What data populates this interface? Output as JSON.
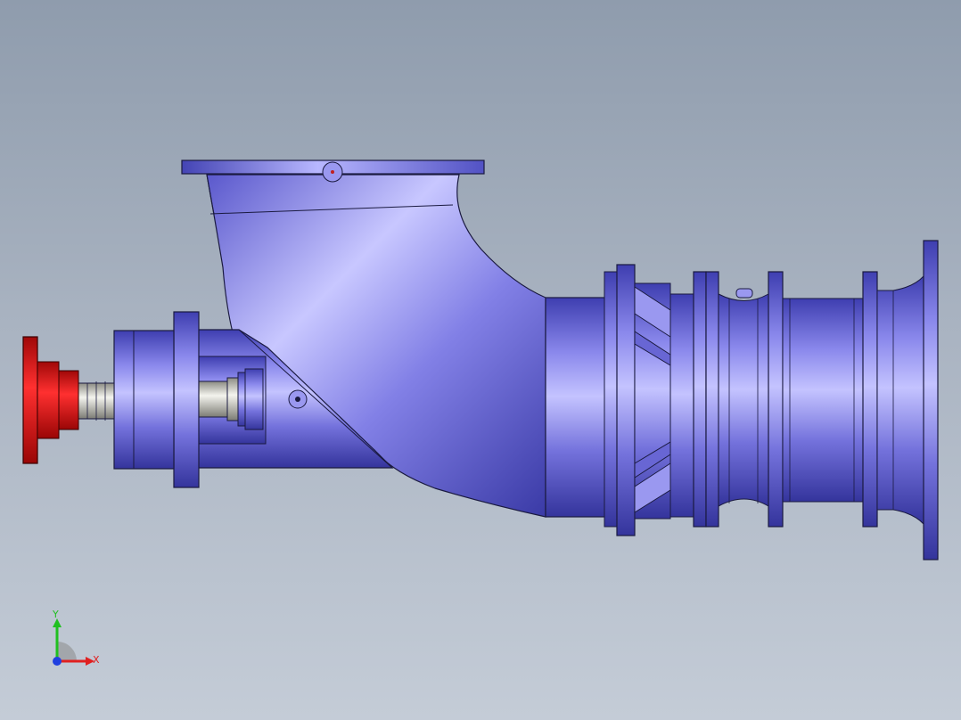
{
  "viewport": {
    "background_top": "#8f9cad",
    "background_bottom": "#c4ccd7"
  },
  "model": {
    "body_color": "#7a78e0",
    "body_highlight": "#c9c8ff",
    "body_shadow": "#3a3aa8",
    "coupling_color": "#e01010",
    "shaft_color": "#c8c8c0",
    "edge_color": "#1a1a40"
  },
  "triad": {
    "x_label": "X",
    "y_label": "Y",
    "x_color": "#e02020",
    "y_color": "#20c020",
    "z_color": "#2040e0"
  }
}
